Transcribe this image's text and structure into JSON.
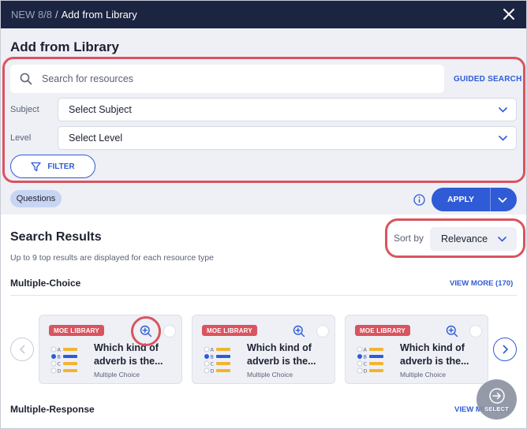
{
  "titlebar": {
    "crumb_new": "NEW 8/8",
    "separator": "/",
    "crumb_current": "Add from Library",
    "close_icon": "close-icon"
  },
  "page": {
    "title": "Add from Library"
  },
  "search": {
    "placeholder": "Search for resources",
    "value": "",
    "guided_label": "GUIDED SEARCH"
  },
  "filters": {
    "subject_label": "Subject",
    "subject_value": "Select Subject",
    "level_label": "Level",
    "level_value": "Select Level",
    "filter_button": "FILTER"
  },
  "tags": {
    "questions_chip": "Questions"
  },
  "apply_button": "APPLY",
  "results": {
    "title": "Search Results",
    "subtitle": "Up to 9 top results are displayed for each resource type",
    "sort_label": "Sort by",
    "sort_value": "Relevance"
  },
  "sections": {
    "multiple_choice": {
      "title": "Multiple-Choice",
      "view_more": "VIEW MORE (170)"
    },
    "multiple_response": {
      "title": "Multiple-Response",
      "view_more": "VIEW MORE (5)"
    }
  },
  "cards": [
    {
      "badge": "MOE LIBRARY",
      "title": "Which kind of adverb is the...",
      "type": "Multiple Choice"
    },
    {
      "badge": "MOE LIBRARY",
      "title": "Which kind of adverb is the...",
      "type": "Multiple Choice"
    },
    {
      "badge": "MOE LIBRARY",
      "title": "Which kind of adverb is the...",
      "type": "Multiple Choice"
    }
  ],
  "fab": {
    "label": "SELECT"
  },
  "colors": {
    "navy": "#1b2440",
    "primary": "#2f5bd6",
    "badge": "#d9545f",
    "highlight": "#d9545f",
    "panel": "#eef0f6"
  }
}
